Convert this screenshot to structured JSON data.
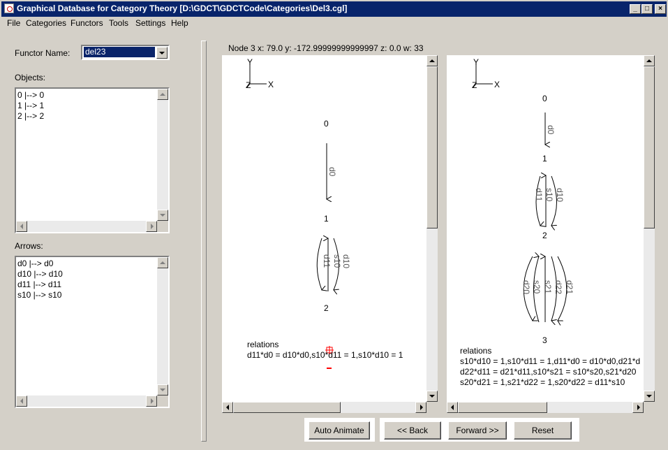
{
  "window": {
    "title": "Graphical Database for Category Theory [D:\\GDCT\\GDCTCode\\Categories\\Del3.cgl]"
  },
  "menu": [
    "File",
    "Categories",
    "Functors",
    "Tools",
    "Settings",
    "Help"
  ],
  "left": {
    "functor_label": "Functor Name:",
    "functor_value": "del23",
    "objects_label": "Objects:",
    "objects": [
      "0 |--> 0",
      "1 |--> 1",
      "2 |--> 2"
    ],
    "arrows_label": "Arrows:",
    "arrows": [
      "d0 |--> d0",
      "d10 |--> d10",
      "d11 |--> d11",
      "s10 |--> s10"
    ]
  },
  "status": "Node 3   x: 79.0  y: -172.99999999999997  z: 0.0   w: 33",
  "pane_left": {
    "axis": {
      "y": "Y",
      "x": "X",
      "z": "Z"
    },
    "nodes": [
      "0",
      "1",
      "2"
    ],
    "arrow_labels": [
      "d0",
      "d11",
      "s10",
      "d10"
    ],
    "relations_title": "relations",
    "relations": [
      "d11*d0 = d10*d0,s10*d11 = 1,s10*d10 = 1"
    ]
  },
  "pane_right": {
    "axis": {
      "y": "Y",
      "x": "X",
      "z": "Z"
    },
    "nodes": [
      "0",
      "1",
      "2",
      "3"
    ],
    "arrow_labels": [
      "d0",
      "d11",
      "s10",
      "d10",
      "d20",
      "s20",
      "s21",
      "d22",
      "d21"
    ],
    "relations_title": "relations",
    "relations": [
      "s10*d10 = 1,s10*d11 = 1,d11*d0 = d10*d0,d21*d",
      "d22*d11 = d21*d11,s10*s21 = s10*s20,s21*d20",
      "s20*d21 = 1,s21*d22 = 1,s20*d22 = d11*s10"
    ]
  },
  "buttons": {
    "auto_animate": "Auto Animate",
    "back": "<< Back",
    "forward": "Forward >>",
    "reset": "Reset"
  },
  "colors": {
    "title_bar": "#08246b",
    "selection": "#0a246a",
    "marker": "#ff0000"
  }
}
